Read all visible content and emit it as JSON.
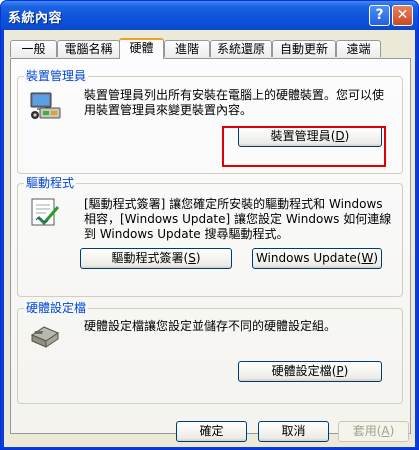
{
  "window": {
    "title": "系統內容",
    "help_glyph": "?",
    "close_glyph": "✕"
  },
  "tabs": [
    {
      "label": "一般"
    },
    {
      "label": "電腦名稱"
    },
    {
      "label": "硬體"
    },
    {
      "label": "進階"
    },
    {
      "label": "系統還原"
    },
    {
      "label": "自動更新"
    },
    {
      "label": "遠端"
    }
  ],
  "device_manager": {
    "title": "裝置管理員",
    "description": "裝置管理員列出所有安裝在電腦上的硬體裝置。您可以使用裝置管理員來變更裝置內容。",
    "button_text": "裝置管理員",
    "button_hotkey": "D",
    "icon": "device-manager-icon"
  },
  "drivers": {
    "title": "驅動程式",
    "description": "[驅動程式簽署] 讓您確定所安裝的驅動程式和 Windows 相容，[Windows Update] 讓您設定 Windows 如何連線到 Windows Update 搜尋驅動程式。",
    "signing_button_text": "驅動程式簽署",
    "signing_button_hotkey": "S",
    "update_button_text": "Windows Update",
    "update_button_hotkey": "W",
    "icon": "driver-signing-icon"
  },
  "hardware_profiles": {
    "title": "硬體設定檔",
    "description": "硬體設定檔讓您設定並儲存不同的硬體設定組。",
    "button_text": "硬體設定檔",
    "button_hotkey": "P",
    "icon": "hardware-profile-icon"
  },
  "footer": {
    "ok": "確定",
    "cancel": "取消",
    "apply": "套用",
    "apply_hotkey": "A"
  },
  "colors": {
    "title_bar": "#0a4fd8",
    "group_title": "#0046d5",
    "highlight": "#e00000"
  }
}
